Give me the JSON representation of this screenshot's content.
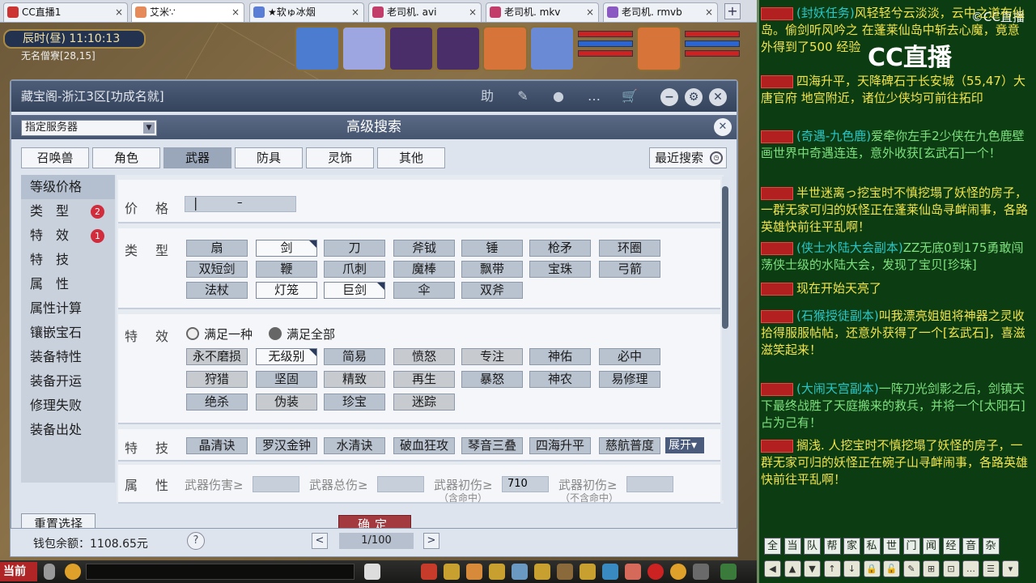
{
  "browser_tabs": [
    {
      "label": "CC直播1",
      "x": "×"
    },
    {
      "label": "艾米∵",
      "x": "×"
    },
    {
      "label": "★软ゅ冰烟",
      "x": "×"
    },
    {
      "label": "老司机. avi",
      "x": "×"
    },
    {
      "label": "老司机. mkv",
      "x": "×"
    },
    {
      "label": "老司机. rmvb",
      "x": "×"
    }
  ],
  "new_tab": "+",
  "game": {
    "time": "辰时(昼)  11:10:13",
    "city_name": "无名僧寮[28,15]"
  },
  "window": {
    "title": "藏宝阁-浙江3区[功成名就]",
    "toolbar_icons": [
      "助",
      "✎",
      "●",
      "…",
      "🛒"
    ],
    "win_buttons": [
      "−",
      "⚙",
      "✕"
    ]
  },
  "search": {
    "heading": "高级搜索",
    "server_select": "指定服务器",
    "categories": [
      "召唤兽",
      "角色",
      "武器",
      "防具",
      "灵饰",
      "其他"
    ],
    "recent": "最近搜索"
  },
  "sidebar": [
    {
      "label": "等级价格",
      "badge": ""
    },
    {
      "label": "类　型",
      "badge": "2"
    },
    {
      "label": "特　效",
      "badge": "1"
    },
    {
      "label": "特　技",
      "badge": ""
    },
    {
      "label": "属　性",
      "badge": ""
    },
    {
      "label": "属性计算",
      "badge": ""
    },
    {
      "label": "镶嵌宝石",
      "badge": ""
    },
    {
      "label": "装备特性",
      "badge": ""
    },
    {
      "label": "装备开运",
      "badge": ""
    },
    {
      "label": "修理失败",
      "badge": ""
    },
    {
      "label": "装备出处",
      "badge": ""
    }
  ],
  "price": {
    "label": "价格",
    "dash": "–"
  },
  "types": {
    "label": "类型",
    "items": [
      "扇",
      "剑",
      "刀",
      "斧钺",
      "锤",
      "枪矛",
      "环圈",
      "双短剑",
      "鞭",
      "爪刺",
      "魔棒",
      "飘带",
      "宝珠",
      "弓箭",
      "法杖",
      "灯笼",
      "巨剑",
      "伞",
      "双斧"
    ]
  },
  "effects": {
    "label": "特效",
    "radio_one": "满足一种",
    "radio_all": "满足全部",
    "items": [
      "永不磨损",
      "无级别",
      "简易",
      "愤怒",
      "专注",
      "神佑",
      "必中",
      "狩猎",
      "坚固",
      "精致",
      "再生",
      "暴怒",
      "神农",
      "易修理",
      "绝杀",
      "伪装",
      "珍宝",
      "迷踪"
    ]
  },
  "skills": {
    "label": "特技",
    "items": [
      "晶清诀",
      "罗汉金钟",
      "水清诀",
      "破血狂攻",
      "琴音三叠",
      "四海升平",
      "慈航普度"
    ],
    "expand": "展开▾"
  },
  "attrs": {
    "label": "属性",
    "items": [
      {
        "label": "武器伤害≥",
        "value": "",
        "sub": ""
      },
      {
        "label": "武器总伤≥",
        "value": "",
        "sub": ""
      },
      {
        "label": "武器初伤≥",
        "value": "710",
        "sub": "（含命中）"
      },
      {
        "label": "武器初伤≥",
        "value": "",
        "sub": "（不含命中）"
      }
    ]
  },
  "footer": {
    "reset": "重置选择",
    "confirm": "确定",
    "wallet": "钱包余额：1108.65元",
    "help": "?",
    "prev": "<",
    "next": ">",
    "page": "1/100"
  },
  "bottom": {
    "current": "当前"
  },
  "chat": {
    "logo_small": "©CC直播",
    "logo": "CC直播",
    "messages": [
      {
        "pre": "(封妖任务)",
        "text": "风轻轻兮云淡淡，云中之道布仙岛。偷剑听风吟之 在蓬莱仙岛中斩去心魔，竟意外得到了500 经验"
      },
      {
        "pre": "",
        "text": "四海升平，天降碑石于长安城（55,47）大唐官府 地宫附近，诸位少侠均可前往拓印"
      },
      {
        "pre": "(奇遇-九色鹿)",
        "text": "爱牵你左手2少侠在九色鹿壁画世界中奇遇连连，意外收获[玄武石]一个！"
      },
      {
        "pre": "",
        "text": "半世迷离っ挖宝时不慎挖塌了妖怪的房子，一群无家可归的妖怪正在蓬莱仙岛寻衅闹事，各路英雄快前往平乱啊！"
      },
      {
        "pre": "(侠士水陆大会副本)",
        "text": "ZZ无底0到175勇敢闯荡侠士级的水陆大会，发现了宝贝[珍珠]"
      },
      {
        "pre": "",
        "text": "现在开始天亮了"
      },
      {
        "pre": "(石猴授徒副本)",
        "text": "叫我漂亮姐姐将神器之灵收拾得服服帖帖，还意外获得了一个[玄武石]，喜滋滋笑起来！"
      },
      {
        "pre": "(大闹天宫副本)",
        "text": "一阵刀光剑影之后，剑镇天下最终战胜了天庭搬来的救兵，并将一个[太阳石]占为己有！"
      },
      {
        "pre": "",
        "text": "搁浅. 人挖宝时不慎挖塌了妖怪的房子，一群无家可归的妖怪正在碗子山寻衅闹事，各路英雄快前往平乱啊！"
      }
    ],
    "channels": [
      "全",
      "当",
      "队",
      "帮",
      "家",
      "私",
      "世",
      "门",
      "闻",
      "经",
      "音",
      "杂"
    ],
    "tools": [
      "◀",
      "▲",
      "▼",
      "↑",
      "↓",
      "🔒",
      "🔓",
      "✎",
      "⊞",
      "⊡",
      "…",
      "☰",
      "▾"
    ]
  },
  "colors": {
    "accent": "#35435c",
    "confirm": "#a23a40",
    "badge": "#d22c3c",
    "chat_bg": "#0b3c12"
  }
}
